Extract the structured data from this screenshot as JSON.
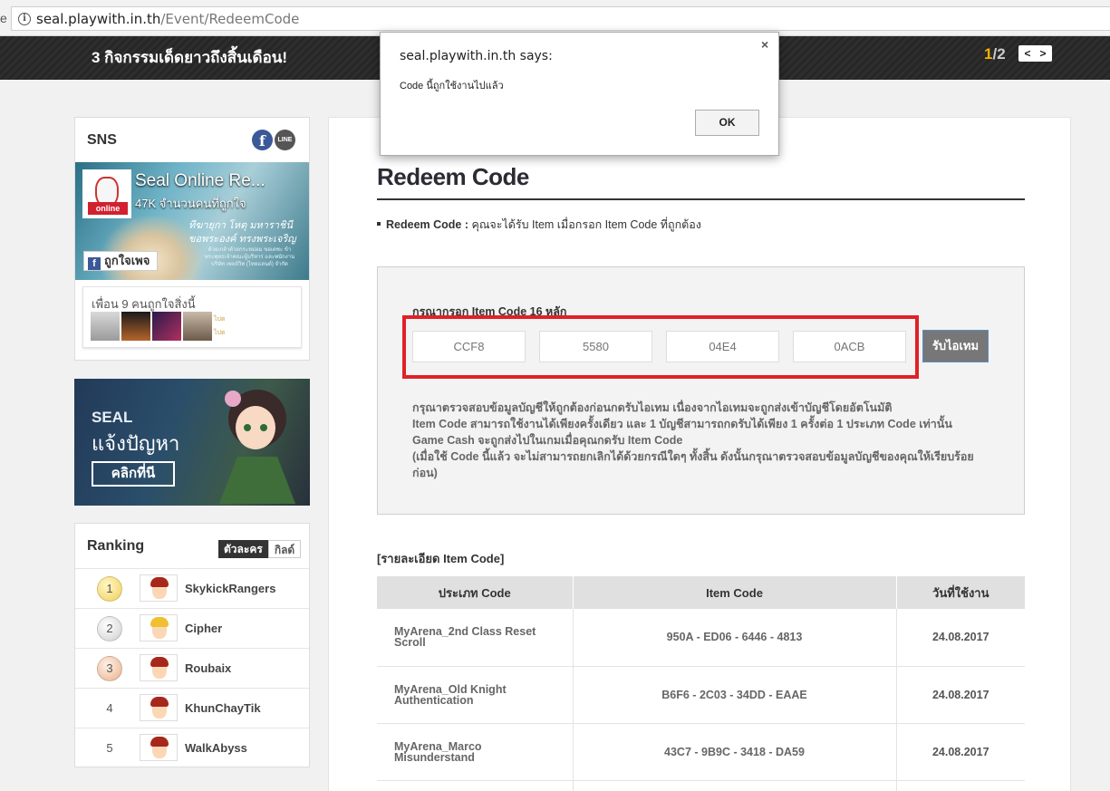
{
  "browser": {
    "url_host": "seal.playwith.in.th",
    "url_path": "/Event/RedeemCode",
    "left_clip": "e"
  },
  "banner": {
    "title": "3 กิจกรรมเด็ดยาวถึงสิ้นเดือน!",
    "page_current": "1",
    "page_total": "/2",
    "prev": "<",
    "next": ">"
  },
  "dialog": {
    "title": "seal.playwith.in.th says:",
    "message": "Code นี้ถูกใช้งานไปแล้ว",
    "ok": "OK",
    "close": "×"
  },
  "sidebar": {
    "sns": {
      "heading": "SNS",
      "fb_letter": "f",
      "line_label": "LINE",
      "page_name": "Seal Online Re...",
      "page_likes": "47K จำนวนคนที่ถูกใจ",
      "avatar_logo": "online",
      "banner_line1": "ทีฆายุกา โหตุ มหาราชินี",
      "banner_line2": "ขอพระองค์ ทรงพระเจริญ",
      "banner_small": "ด้วยเกล้าด้วยกระหม่อม ขอเดชะ ข้าพระพุทธเจ้าคณะผู้บริหาร และพนักงาน บริษัท เพลย์วิท (ไทยแลนด์) จำกัด",
      "like_label": "ถูกใจเพจ",
      "friends_text": "เพื่อน 9 คนถูกใจสิ่งนี้",
      "mini_link": "ไปต"
    },
    "promo": {
      "brand": "SEAL",
      "title": "แจ้งปัญหา",
      "button": "คลิกที่นี"
    },
    "ranking": {
      "heading": "Ranking",
      "tab_character": "ตัวละคร",
      "tab_guild": "กิลด์",
      "rows": [
        {
          "rank": "1",
          "name": "SkykickRangers",
          "hair": "#a8271b"
        },
        {
          "rank": "2",
          "name": "Cipher",
          "hair": "#f0c030"
        },
        {
          "rank": "3",
          "name": "Roubaix",
          "hair": "#a8271b"
        },
        {
          "rank": "4",
          "name": "KhunChayTik",
          "hair": "#a8271b"
        },
        {
          "rank": "5",
          "name": "WalkAbyss",
          "hair": "#a8271b"
        }
      ]
    }
  },
  "main": {
    "title": "Redeem Code",
    "intro_label": "Redeem Code :",
    "intro_text": " คุณจะได้รับ Item เมื่อกรอก Item Code ที่ถูกต้อง",
    "prompt": "กรุณากรอก Item Code 16 หลัก",
    "code_parts": [
      "CCF8",
      "5580",
      "04E4",
      "0ACB"
    ],
    "separator": "-",
    "submit": "รับไอเทม",
    "notes": [
      "กรุณาตรวจสอบข้อมูลบัญชีให้ถูกต้องก่อนกดรับไอเทม เนื่องจากไอเทมจะถูกส่งเข้าบัญชีโดยอัตโนมัติ",
      "Item Code สามารถใช้งานได้เพียงครั้งเดียว และ 1 บัญชีสามารถกดรับได้เพียง 1 ครั้งต่อ 1 ประเภท Code เท่านั้น",
      "Game Cash จะถูกส่งไปในเกมเมื่อคุณกดรับ Item Code",
      "(เมื่อใช้ Code นี้แล้ว จะไม่สามารถยกเลิกได้ด้วยกรณีใดๆ ทั้งสิ้น ดังนั้นกรุณาตรวจสอบข้อมูลบัญชีของคุณให้เรียบร้อย",
      "ก่อน)"
    ],
    "detail_heading": "[รายละเอียด Item Code]",
    "table": {
      "headers": [
        "ประเภท Code",
        "Item Code",
        "วันที่ใช้งาน"
      ],
      "rows": [
        {
          "type_line1": "MyArena_2nd Class Reset",
          "type_line2": "Scroll",
          "code": "950A - ED06 - 6446 - 4813",
          "date": "24.08.2017"
        },
        {
          "type_line1": "MyArena_Old Knight",
          "type_line2": "Authentication",
          "code": "B6F6 - 2C03 - 34DD - EAAE",
          "date": "24.08.2017"
        },
        {
          "type_line1": "MyArena_Marco",
          "type_line2": "Misunderstand",
          "code": "43C7 - 9B9C - 3418 - DA59",
          "date": "24.08.2017"
        }
      ]
    }
  }
}
